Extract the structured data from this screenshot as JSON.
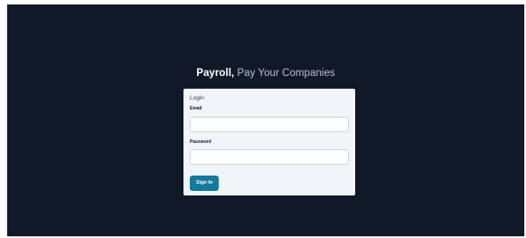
{
  "brand": {
    "name": "Payroll,",
    "tagline": " Pay Your Companies"
  },
  "login": {
    "title": "Login",
    "email_label": "Email",
    "email_value": "",
    "password_label": "Password",
    "password_value": "",
    "submit_label": "Sign In"
  },
  "colors": {
    "background": "#111827",
    "card": "#f1f5f9",
    "button": "#137a9b"
  }
}
